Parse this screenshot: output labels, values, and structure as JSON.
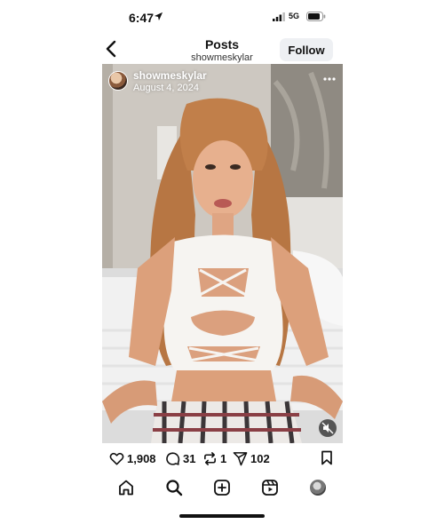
{
  "status_bar": {
    "time": "6:47",
    "network": "5G",
    "location_icon": "location-arrow-icon",
    "signal_icon": "cellular-signal-icon",
    "battery_icon": "battery-icon"
  },
  "header": {
    "title": "Posts",
    "subtitle": "showmeskylar",
    "follow_label": "Follow",
    "back_icon": "chevron-left-icon"
  },
  "post": {
    "username": "showmeskylar",
    "date": "August 4, 2024",
    "more_icon": "more-horizontal-icon",
    "mute_icon": "speaker-muted-icon"
  },
  "actions": {
    "likes": "1,908",
    "comments": "31",
    "reposts": "1",
    "shares": "102"
  },
  "tabs": [
    "home-icon",
    "search-icon",
    "create-post-icon",
    "reels-icon",
    "profile-avatar"
  ],
  "colors": {
    "text": "#111111",
    "follow_button_bg": "#eef0f3",
    "background": "#ffffff"
  }
}
